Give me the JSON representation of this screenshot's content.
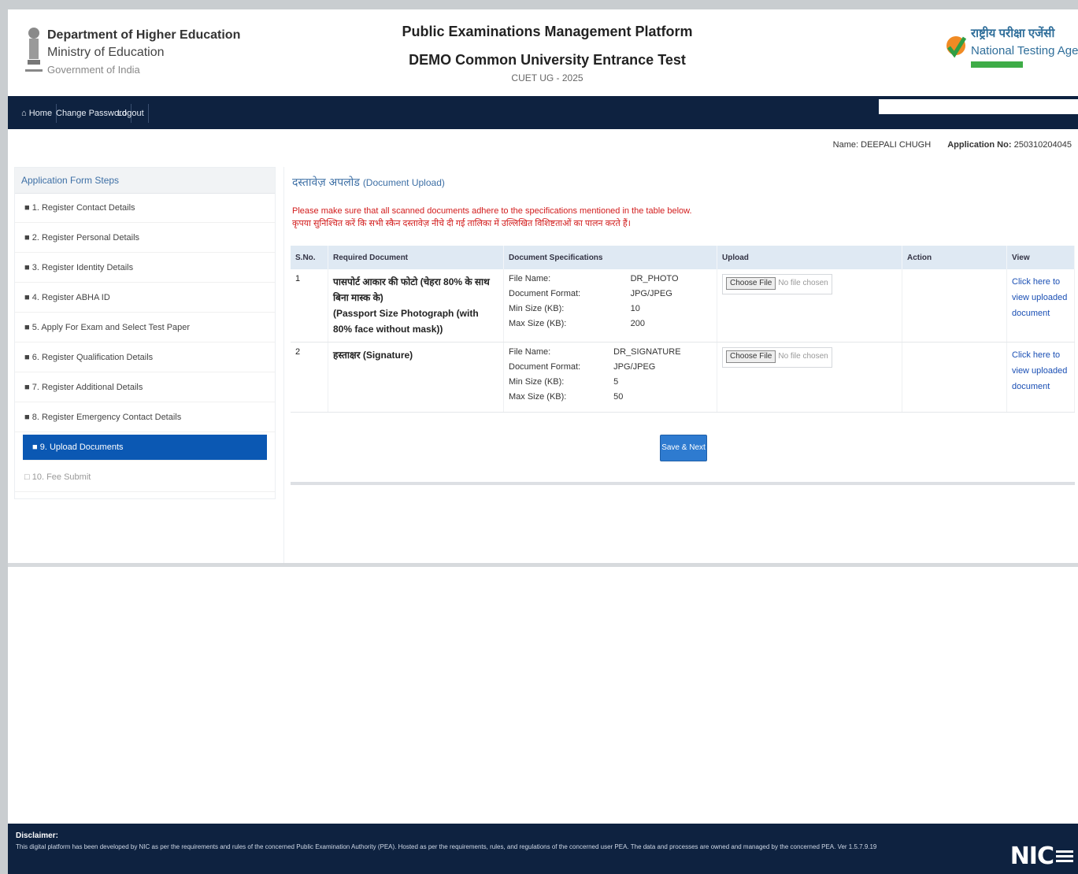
{
  "header": {
    "dept_line1": "Department of Higher Education",
    "dept_line2": "Ministry of Education",
    "dept_line3": "Government of India",
    "platform_title": "Public Examinations Management Platform",
    "exam_title": "DEMO Common University Entrance Test",
    "exam_code": "CUET UG - 2025",
    "agency_hindi": "राष्ट्रीय परीक्षा एजेंसी",
    "agency_name": "National Testing Agency"
  },
  "nav": {
    "home": "Home",
    "change_password": "Change Password",
    "logout": "Logout",
    "search_value": ""
  },
  "user": {
    "name_label": "Name:",
    "name_value": "DEEPALI CHUGH",
    "app_label": "Application No:",
    "app_value": "250310204045"
  },
  "sidebar": {
    "heading": "Application Form Steps",
    "items": [
      {
        "label": "1. Register Contact Details"
      },
      {
        "label": "2. Register Personal Details"
      },
      {
        "label": "3. Register Identity Details"
      },
      {
        "label": "4. Register ABHA ID"
      },
      {
        "label": "5. Apply For Exam and Select Test Paper"
      },
      {
        "label": "6. Register Qualification Details"
      },
      {
        "label": "7. Register Additional Details"
      },
      {
        "label": "8. Register Emergency Contact Details"
      },
      {
        "label": "9. Upload Documents"
      },
      {
        "label": "10. Fee Submit"
      }
    ]
  },
  "main": {
    "title_hindi": "दस्तावेज़ अपलोड",
    "title_en": "(Document Upload)",
    "note_en": "Please make sure that all scanned documents adhere to the specifications mentioned in the table below.",
    "note_hi": "कृपया सुनिश्चित करें कि सभी स्कैन दस्तावेज़ नीचे दी गई तालिका में उल्लिखित विशिष्टताओं का पालन करते हैं।",
    "headers": {
      "sno": "S.No.",
      "required": "Required Document",
      "spec": "Document Specifications",
      "upload": "Upload",
      "action": "Action",
      "view": "View"
    },
    "spec_labels": {
      "file_name": "File Name:",
      "format": "Document Format:",
      "min": "Min Size (KB):",
      "max": "Max Size (KB):"
    },
    "rows": [
      {
        "sno": "1",
        "doc_hindi": "पासपोर्ट आकार की फोटो (चेहरा 80% के साथ बिना मास्क के)",
        "doc_en": "(Passport Size Photograph (with 80% face without mask))",
        "file_name": "DR_PHOTO",
        "format": "JPG/JPEG",
        "min": "10",
        "max": "200",
        "choose_label": "Choose File",
        "no_file": "No file chosen",
        "view_link": "Click here to view uploaded document"
      },
      {
        "sno": "2",
        "doc_hindi": "हस्ताक्षर (Signature)",
        "doc_en": "",
        "file_name": "DR_SIGNATURE",
        "format": "JPG/JPEG",
        "min": "5",
        "max": "50",
        "choose_label": "Choose File",
        "no_file": "No file chosen",
        "view_link": "Click here to view uploaded document"
      }
    ],
    "save_label": "Save & Next"
  },
  "footer": {
    "disclaimer_title": "Disclaimer:",
    "disclaimer_text": "This digital platform has been developed by NIC as per the requirements and rules of the concerned Public Examination Authority (PEA). Hosted as per the requirements, rules, and regulations of the concerned user PEA. The data and processes are owned and managed by the concerned PEA. Ver 1.5.7.9.19",
    "nic_logo": "NIC"
  }
}
